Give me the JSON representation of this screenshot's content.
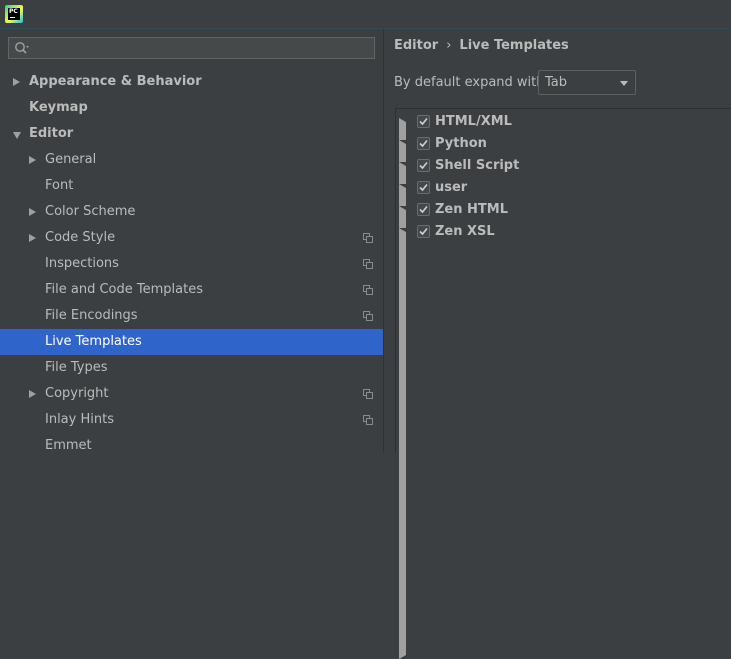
{
  "app": {
    "icon_text": "PC"
  },
  "search": {
    "placeholder": "",
    "value": ""
  },
  "sidebar": {
    "items": [
      {
        "label": "Appearance & Behavior",
        "level": 0,
        "arrow": "collapsed",
        "bold": true,
        "copy_icon": false,
        "selected": false
      },
      {
        "label": "Keymap",
        "level": 0,
        "arrow": "none",
        "bold": true,
        "copy_icon": false,
        "selected": false
      },
      {
        "label": "Editor",
        "level": 0,
        "arrow": "expanded",
        "bold": true,
        "copy_icon": false,
        "selected": false
      },
      {
        "label": "General",
        "level": 1,
        "arrow": "collapsed",
        "bold": false,
        "copy_icon": false,
        "selected": false
      },
      {
        "label": "Font",
        "level": 1,
        "arrow": "none",
        "bold": false,
        "copy_icon": false,
        "selected": false
      },
      {
        "label": "Color Scheme",
        "level": 1,
        "arrow": "collapsed",
        "bold": false,
        "copy_icon": false,
        "selected": false
      },
      {
        "label": "Code Style",
        "level": 1,
        "arrow": "collapsed",
        "bold": false,
        "copy_icon": true,
        "selected": false
      },
      {
        "label": "Inspections",
        "level": 1,
        "arrow": "none",
        "bold": false,
        "copy_icon": true,
        "selected": false
      },
      {
        "label": "File and Code Templates",
        "level": 1,
        "arrow": "none",
        "bold": false,
        "copy_icon": true,
        "selected": false
      },
      {
        "label": "File Encodings",
        "level": 1,
        "arrow": "none",
        "bold": false,
        "copy_icon": true,
        "selected": false
      },
      {
        "label": "Live Templates",
        "level": 1,
        "arrow": "none",
        "bold": false,
        "copy_icon": false,
        "selected": true
      },
      {
        "label": "File Types",
        "level": 1,
        "arrow": "none",
        "bold": false,
        "copy_icon": false,
        "selected": false
      },
      {
        "label": "Copyright",
        "level": 1,
        "arrow": "collapsed",
        "bold": false,
        "copy_icon": true,
        "selected": false
      },
      {
        "label": "Inlay Hints",
        "level": 1,
        "arrow": "none",
        "bold": false,
        "copy_icon": true,
        "selected": false
      },
      {
        "label": "Emmet",
        "level": 1,
        "arrow": "none",
        "bold": false,
        "copy_icon": false,
        "selected": false
      }
    ]
  },
  "breadcrumb": {
    "parent": "Editor",
    "separator": "›",
    "current": "Live Templates"
  },
  "expand": {
    "label": "By default expand with",
    "value": "Tab"
  },
  "template_groups": [
    {
      "name": "HTML/XML",
      "checked": true
    },
    {
      "name": "Python",
      "checked": true
    },
    {
      "name": "Shell Script",
      "checked": true
    },
    {
      "name": "user",
      "checked": true
    },
    {
      "name": "Zen HTML",
      "checked": true
    },
    {
      "name": "Zen XSL",
      "checked": true
    }
  ],
  "colors": {
    "background": "#3c3f41",
    "selection": "#2f65ca",
    "text": "#bbbbbb",
    "accent_line": "#2b4d5b"
  }
}
